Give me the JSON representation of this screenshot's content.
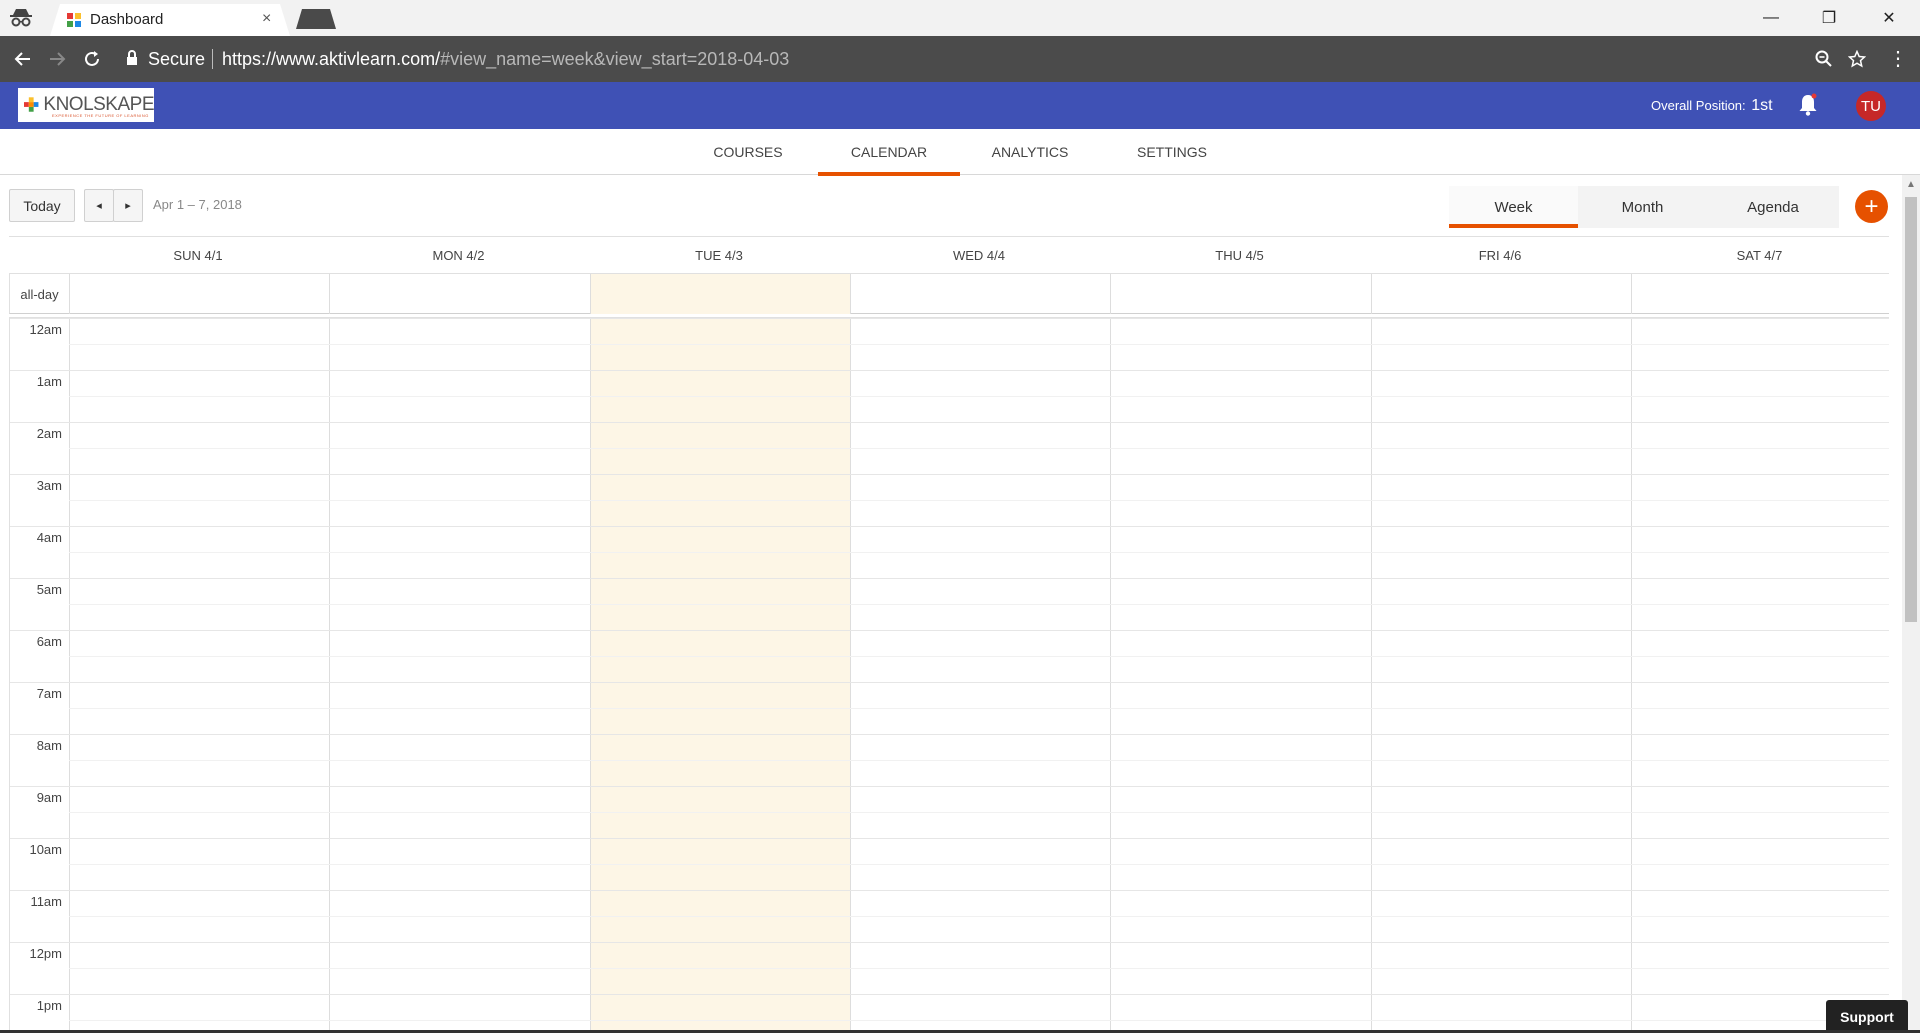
{
  "browser": {
    "tab_title": "Dashboard",
    "tab_close": "×",
    "secure_label": "Secure",
    "url_host": "https://www.aktivlearn.com/",
    "url_rest": "#view_name=week&view_start=2018-04-03",
    "win_minimize": "—",
    "win_restore": "❐",
    "win_close": "✕"
  },
  "app": {
    "logo_text": "KNOLSKAPE",
    "logo_tagline": "EXPERIENCE THE FUTURE OF LEARNING",
    "position_label": "Overall Position:",
    "position_value": "1st",
    "avatar_initials": "TU",
    "accent_color": "#e65100",
    "header_color": "#3f51b5"
  },
  "nav": {
    "items": [
      {
        "label": "COURSES"
      },
      {
        "label": "CALENDAR",
        "active": true
      },
      {
        "label": "ANALYTICS"
      },
      {
        "label": "SETTINGS"
      }
    ]
  },
  "toolbar": {
    "today_label": "Today",
    "prev_label": "◂",
    "next_label": "▸",
    "range": "Apr 1 – 7, 2018",
    "views": [
      {
        "label": "Week",
        "active": true
      },
      {
        "label": "Month"
      },
      {
        "label": "Agenda"
      }
    ],
    "add_label": "+"
  },
  "calendar": {
    "allday_label": "all-day",
    "days": [
      "SUN 4/1",
      "MON 4/2",
      "TUE 4/3",
      "WED 4/4",
      "THU 4/5",
      "FRI 4/6",
      "SAT 4/7"
    ],
    "today_index": 2,
    "times": [
      "12am",
      "1am",
      "2am",
      "3am",
      "4am",
      "5am",
      "6am",
      "7am",
      "8am",
      "9am",
      "10am",
      "11am",
      "12pm",
      "1pm"
    ]
  },
  "support_label": "Support"
}
